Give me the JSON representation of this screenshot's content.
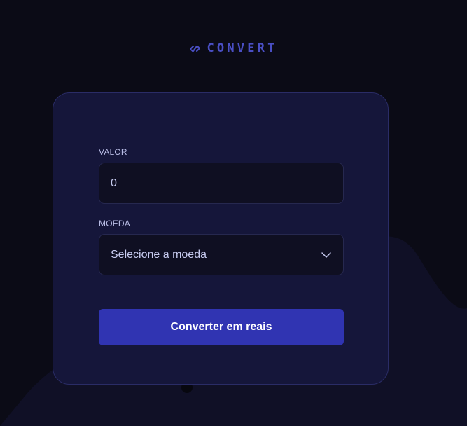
{
  "logo": {
    "text": "CONVERT",
    "icon": "convert-arrows-icon"
  },
  "form": {
    "valor": {
      "label": "VALOR",
      "value": "0"
    },
    "moeda": {
      "label": "MOEDA",
      "placeholder": "Selecione a moeda",
      "icon": "chevron-down-icon"
    },
    "submit_label": "Converter em reais"
  },
  "colors": {
    "background": "#0b0b16",
    "card": "#15163a",
    "accent": "#4a4fc4",
    "button": "#3034b2"
  }
}
